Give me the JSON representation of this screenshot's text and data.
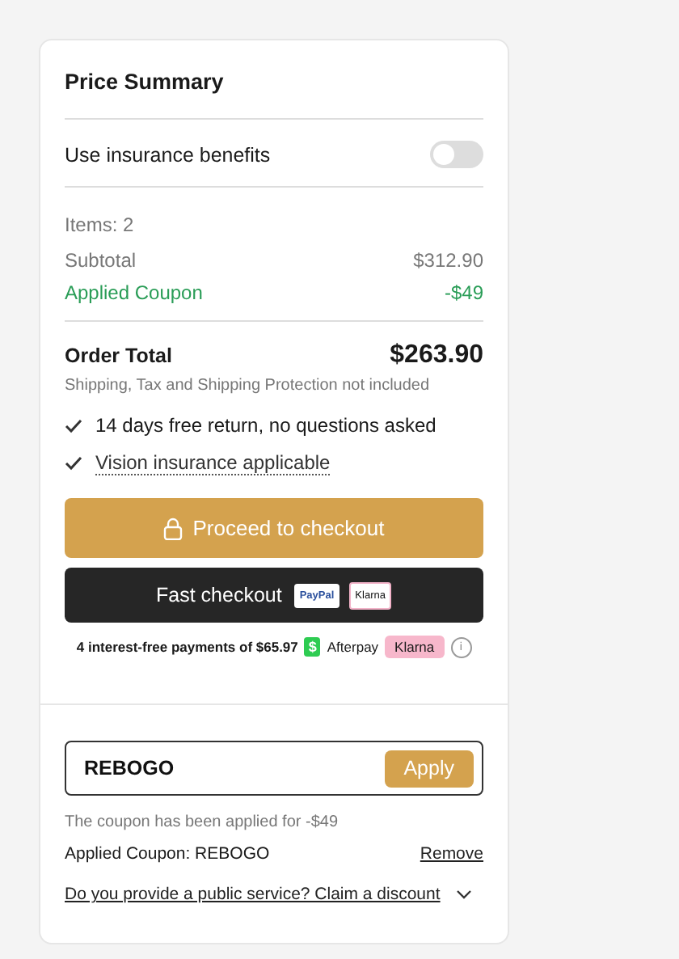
{
  "title": "Price Summary",
  "insurance": {
    "label": "Use insurance benefits",
    "on": false
  },
  "items_count": "Items: 2",
  "lines": [
    {
      "label": "Subtotal",
      "value": "$312.90",
      "kind": "plain"
    },
    {
      "label": "Applied Coupon",
      "value": "-$49",
      "kind": "discount"
    }
  ],
  "total": {
    "label": "Order Total",
    "value": "$263.90",
    "note": "Shipping, Tax and Shipping Protection not included"
  },
  "benefits": [
    {
      "text": "14 days free return, no questions asked",
      "kind": "plain"
    },
    {
      "text": "Vision insurance applicable",
      "kind": "link"
    }
  ],
  "checkout_button": "Proceed to checkout",
  "fast_checkout": {
    "label": "Fast checkout",
    "badges": [
      "PayPal",
      "Klarna"
    ]
  },
  "installments": {
    "text": "4 interest-free payments of $65.97",
    "afterpay_icon": "$",
    "afterpay": "Afterpay",
    "klarna": "Klarna",
    "info": "i"
  },
  "coupon": {
    "value": "REBOGO",
    "apply": "Apply",
    "message": "The coupon has been applied for -$49",
    "applied": "Applied Coupon: REBOGO",
    "remove": "Remove"
  },
  "public_service": "Do you provide a public service? Claim a discount"
}
